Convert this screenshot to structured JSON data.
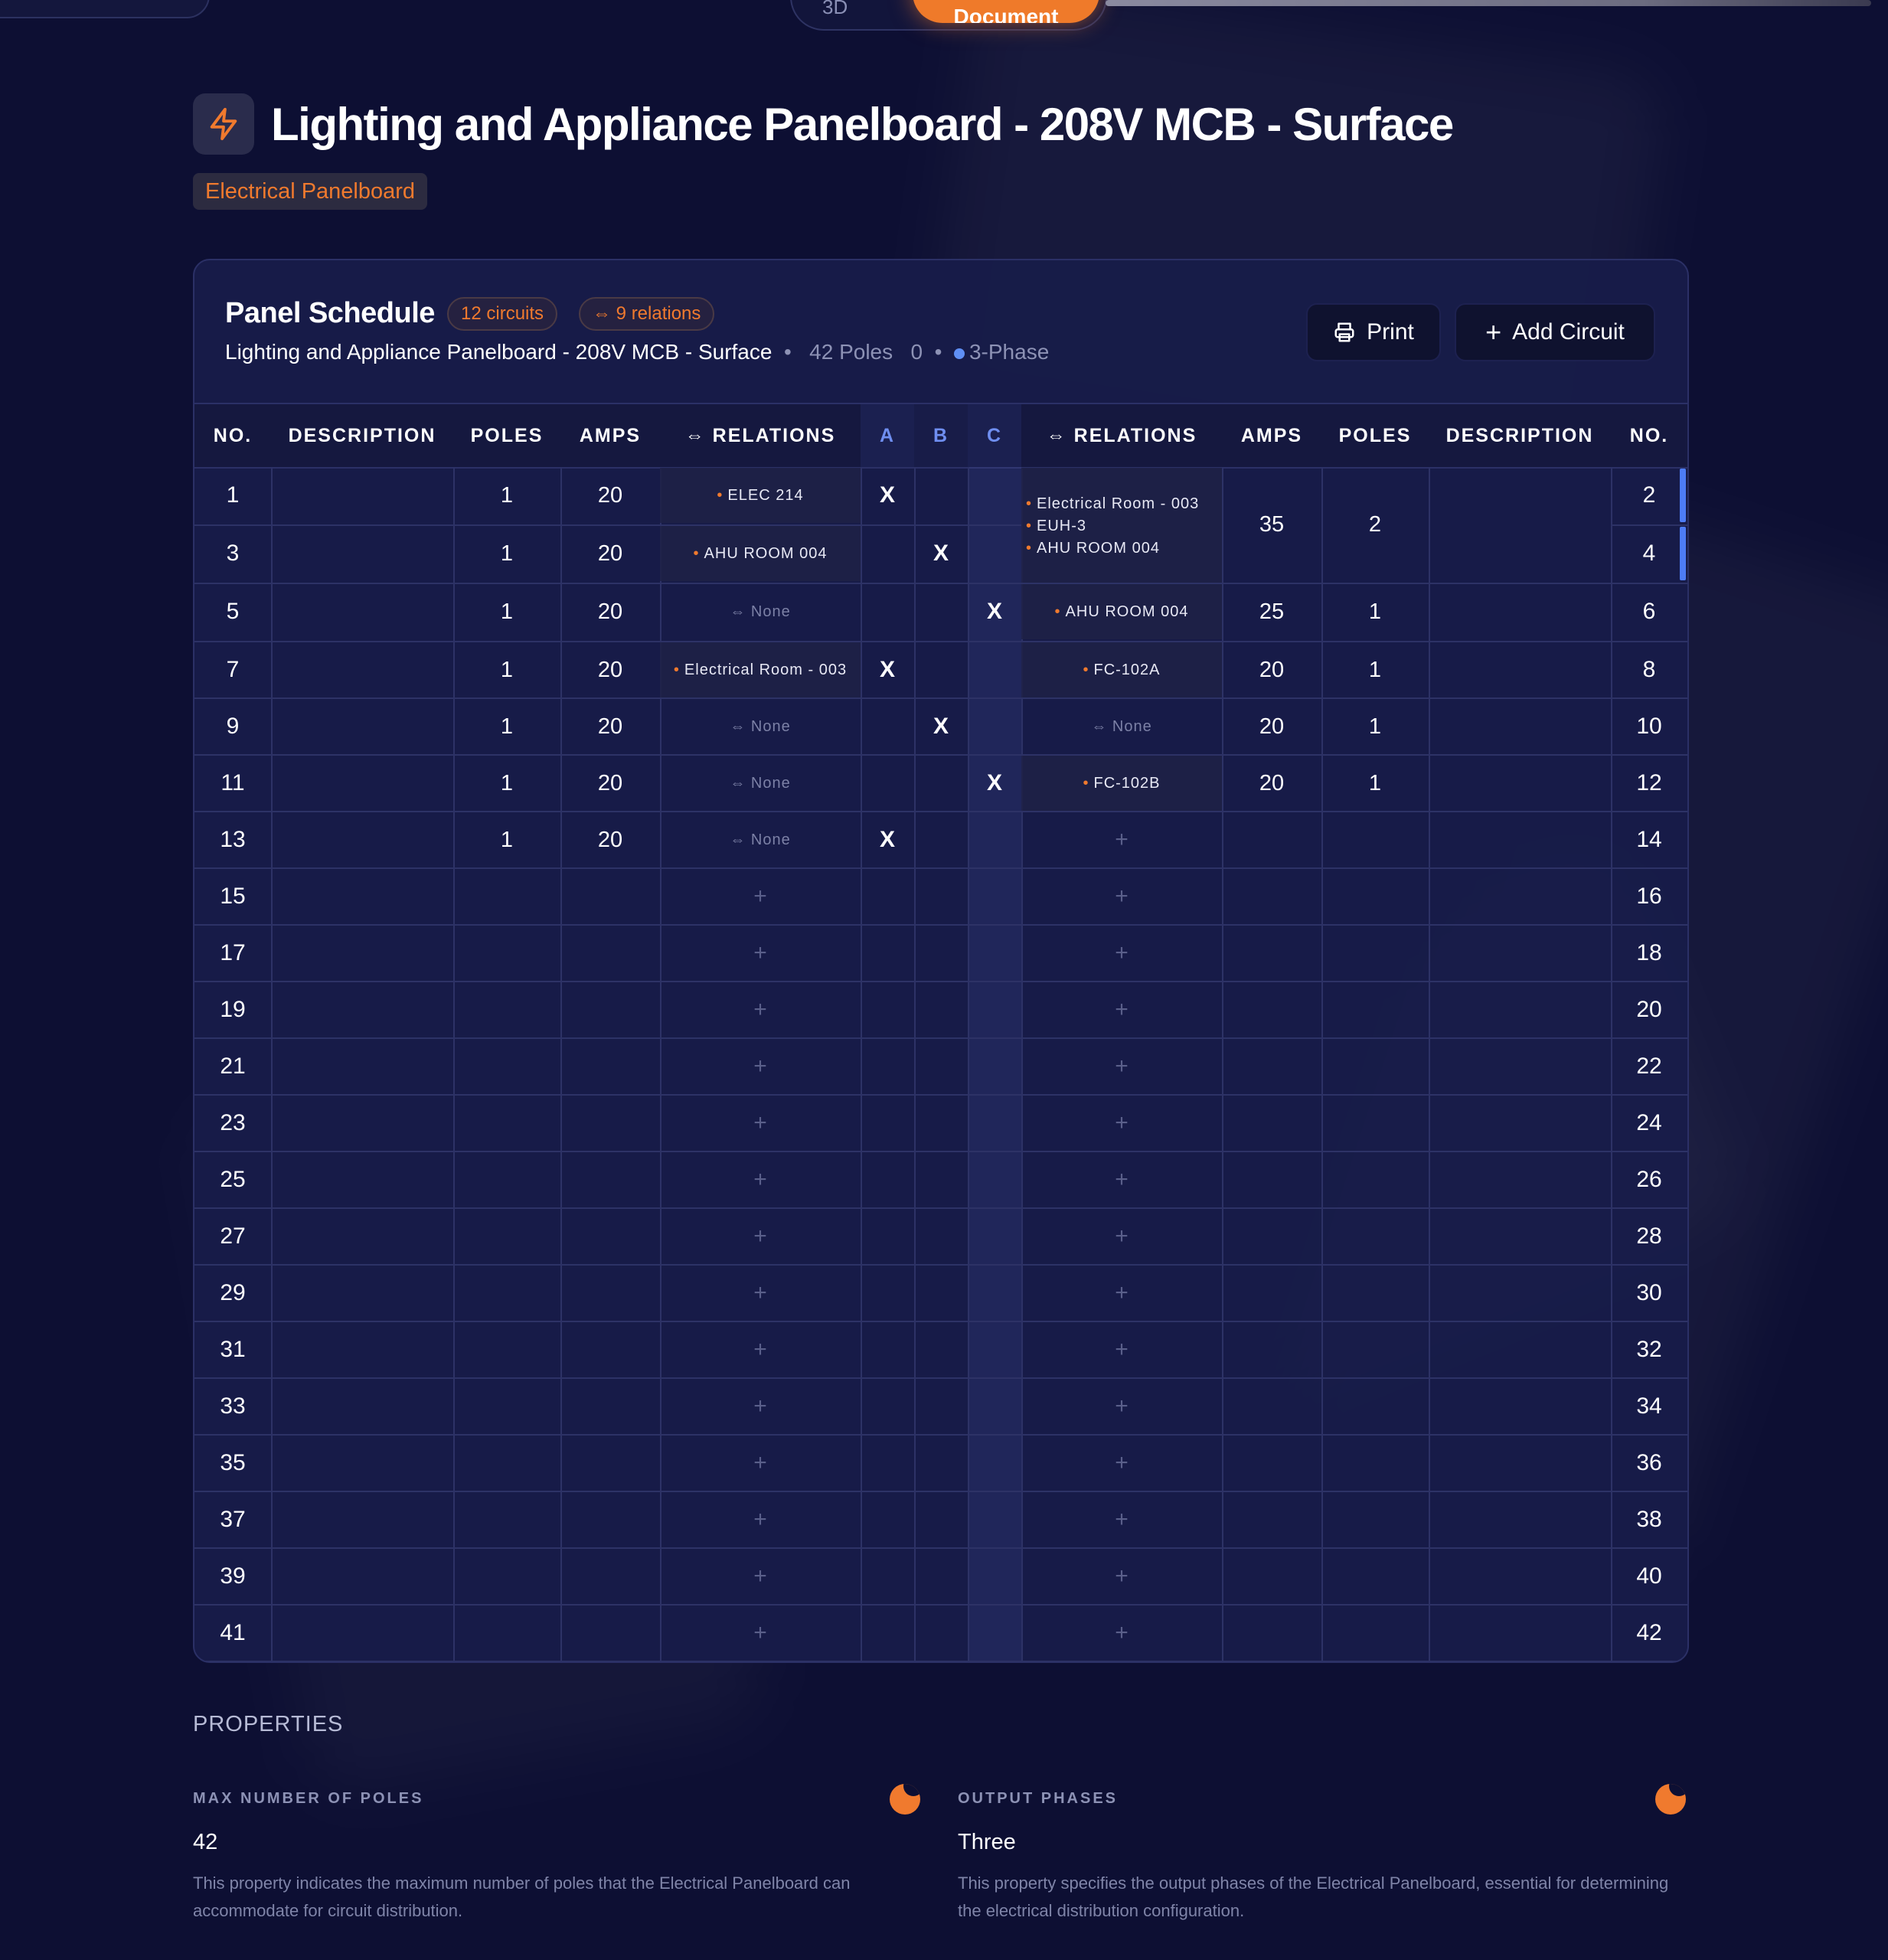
{
  "topbar": {
    "toggle_3d": "3D",
    "toggle_document": "Document"
  },
  "header": {
    "title": "Lighting and Appliance Panelboard - 208V MCB - Surface",
    "badge": "Electrical Panelboard"
  },
  "panel": {
    "title": "Panel Schedule",
    "circuits_chip": "12 circuits",
    "relations_chip": "9 relations",
    "subtitle_name": "Lighting and Appliance Panelboard - 208V MCB - Surface",
    "subtitle_poles": "42 Poles",
    "subtitle_zero": "0",
    "subtitle_phase": "3-Phase",
    "print_label": "Print",
    "add_label": "Add Circuit",
    "phase_color": "#5f8ff5",
    "accent_color": "#f07a2e"
  },
  "table": {
    "headers": {
      "no_left": "NO.",
      "desc_left": "DESCRIPTION",
      "poles_left": "POLES",
      "amps_left": "AMPS",
      "rel_left": "RELATIONS",
      "a": "A",
      "b": "B",
      "c": "C",
      "rel_right": "RELATIONS",
      "amps_right": "AMPS",
      "poles_right": "POLES",
      "desc_right": "DESCRIPTION",
      "no_right": "NO."
    },
    "none_label": "None",
    "x_mark": "X",
    "left": [
      {
        "no": "1",
        "poles": "1",
        "amps": "20",
        "relation": "ELEC 214",
        "phase": "A"
      },
      {
        "no": "3",
        "poles": "1",
        "amps": "20",
        "relation": "AHU ROOM 004",
        "phase": "B"
      },
      {
        "no": "5",
        "poles": "1",
        "amps": "20",
        "relation": "None",
        "phase": "C"
      },
      {
        "no": "7",
        "poles": "1",
        "amps": "20",
        "relation": "Electrical Room - 003",
        "phase": "A"
      },
      {
        "no": "9",
        "poles": "1",
        "amps": "20",
        "relation": "None",
        "phase": "B"
      },
      {
        "no": "11",
        "poles": "1",
        "amps": "20",
        "relation": "None",
        "phase": "C"
      },
      {
        "no": "13",
        "poles": "1",
        "amps": "20",
        "relation": "None",
        "phase": "A"
      },
      {
        "no": "15"
      },
      {
        "no": "17"
      },
      {
        "no": "19"
      },
      {
        "no": "21"
      },
      {
        "no": "23"
      },
      {
        "no": "25"
      },
      {
        "no": "27"
      },
      {
        "no": "29"
      },
      {
        "no": "31"
      },
      {
        "no": "33"
      },
      {
        "no": "35"
      },
      {
        "no": "37"
      },
      {
        "no": "39"
      },
      {
        "no": "41"
      }
    ],
    "right": [
      {
        "no": "2"
      },
      {
        "no": "4"
      },
      {
        "no": "6",
        "poles": "1",
        "amps": "25",
        "relation": "AHU ROOM 004"
      },
      {
        "no": "8",
        "poles": "1",
        "amps": "20",
        "relation": "FC-102A"
      },
      {
        "no": "10",
        "poles": "1",
        "amps": "20",
        "relation": "None"
      },
      {
        "no": "12",
        "poles": "1",
        "amps": "20",
        "relation": "FC-102B"
      },
      {
        "no": "14"
      },
      {
        "no": "16"
      },
      {
        "no": "18"
      },
      {
        "no": "20"
      },
      {
        "no": "22"
      },
      {
        "no": "24"
      },
      {
        "no": "26"
      },
      {
        "no": "28"
      },
      {
        "no": "30"
      },
      {
        "no": "32"
      },
      {
        "no": "34"
      },
      {
        "no": "36"
      },
      {
        "no": "38"
      },
      {
        "no": "40"
      },
      {
        "no": "42"
      }
    ],
    "right_multi": {
      "amps": "35",
      "poles": "2",
      "relations": [
        "Electrical Room - 003",
        "EUH-3",
        "AHU ROOM 004"
      ]
    }
  },
  "properties": {
    "title": "PROPERTIES",
    "items": [
      {
        "label": "MAX NUMBER OF POLES",
        "value": "42",
        "description": "This property indicates the maximum number of poles that the Electrical Panelboard can accommodate for circuit distribution."
      },
      {
        "label": "OUTPUT PHASES",
        "value": "Three",
        "description": "This property specifies the output phases of the Electrical Panelboard, essential for determining the electrical distribution configuration."
      }
    ]
  }
}
